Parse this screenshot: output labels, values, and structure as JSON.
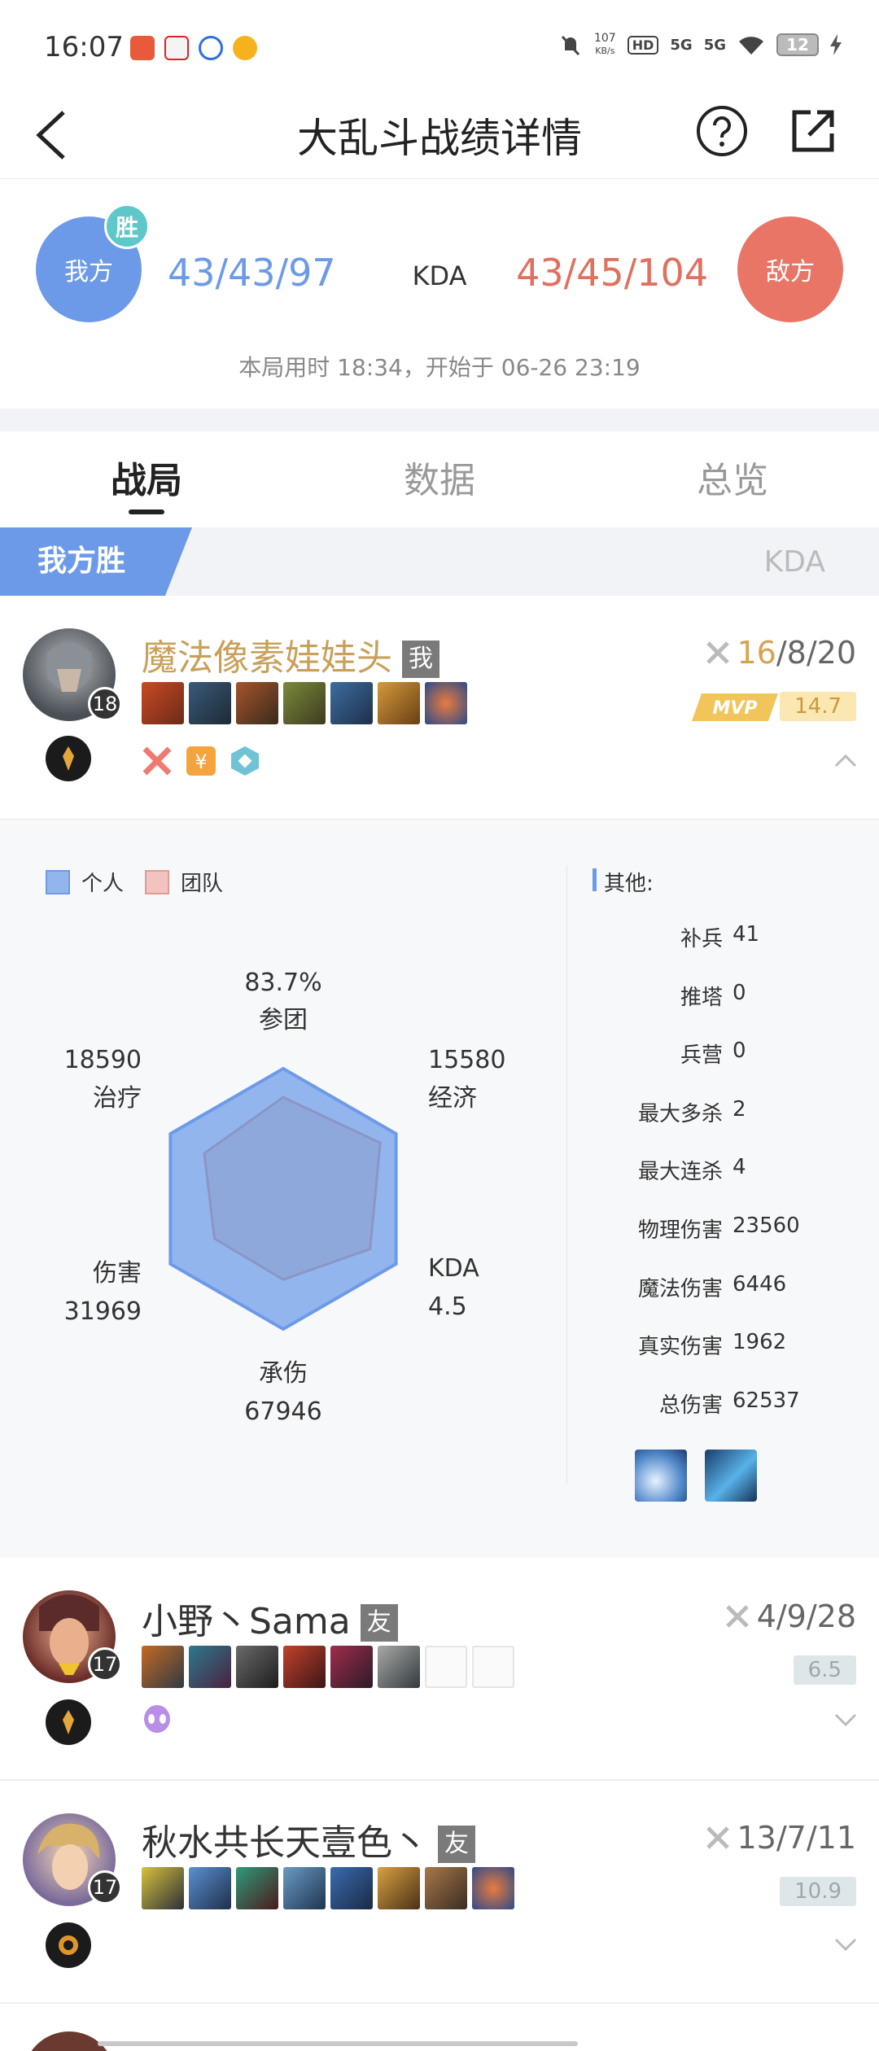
{
  "status_bar": {
    "time": "16:07",
    "net_speed": "107",
    "net_unit": "KB/s",
    "hd_label": "HD",
    "sim_1": "5G",
    "sim_2": "5G",
    "battery": "12",
    "apps": [
      "listen-app-icon",
      "bilibili-style-icon",
      "baidu-icon",
      "weibo-icon"
    ]
  },
  "header": {
    "title": "大乱斗战绩详情",
    "icons": [
      "back-arrow-icon",
      "help-icon",
      "share-icon"
    ]
  },
  "summary": {
    "our_team_label": "我方",
    "win_badge": "胜",
    "our_kda": "43/43/97",
    "kda_label": "KDA",
    "enemy_kda": "43/45/104",
    "enemy_team_label": "敌方",
    "match_time": "本局用时 18:34，开始于 06-26 23:19",
    "colors": {
      "ours": "#6d9ae8",
      "enemy": "#e87565"
    }
  },
  "tabs": [
    {
      "label": "战局",
      "active": true
    },
    {
      "label": "数据",
      "active": false
    },
    {
      "label": "总览",
      "active": false
    }
  ],
  "result_band": {
    "result": "我方胜",
    "column_label": "KDA"
  },
  "players": [
    {
      "name": "魔法像素娃娃头",
      "tag": "我",
      "level": "18",
      "kills": "16",
      "rest": "/8/20",
      "score": "14.7",
      "mvp": "MVP",
      "expanded": true
    },
    {
      "name": "小野丶Sama",
      "tag": "友",
      "level": "17",
      "kda": "4/9/28",
      "score": "6.5",
      "expanded": false
    },
    {
      "name": "秋水共长天壹色丶",
      "tag": "友",
      "level": "17",
      "kda": "13/7/11",
      "score": "10.9",
      "expanded": false
    }
  ],
  "stats": {
    "legend": {
      "personal": "个人",
      "team": "团队"
    },
    "radar_axes": [
      {
        "value": "83.7%",
        "label": "参团"
      },
      {
        "value": "15580",
        "label": "经济"
      },
      {
        "label": "KDA",
        "value": "4.5"
      },
      {
        "label": "承伤",
        "value": "67946"
      },
      {
        "label": "伤害",
        "value": "31969"
      },
      {
        "value": "18590",
        "label": "治疗"
      }
    ],
    "personal_levels": [
      0.78,
      0.86,
      0.77,
      0.62,
      0.61,
      0.7
    ],
    "other_title": "其他:",
    "rows": [
      {
        "label": "补兵",
        "value": "41"
      },
      {
        "label": "推塔",
        "value": "0"
      },
      {
        "label": "兵营",
        "value": "0"
      },
      {
        "label": "最大多杀",
        "value": "2"
      },
      {
        "label": "最大连杀",
        "value": "4"
      },
      {
        "label": "物理伤害",
        "value": "23560"
      },
      {
        "label": "魔法伤害",
        "value": "6446"
      },
      {
        "label": "真实伤害",
        "value": "1962"
      },
      {
        "label": "总伤害",
        "value": "62537"
      }
    ]
  }
}
